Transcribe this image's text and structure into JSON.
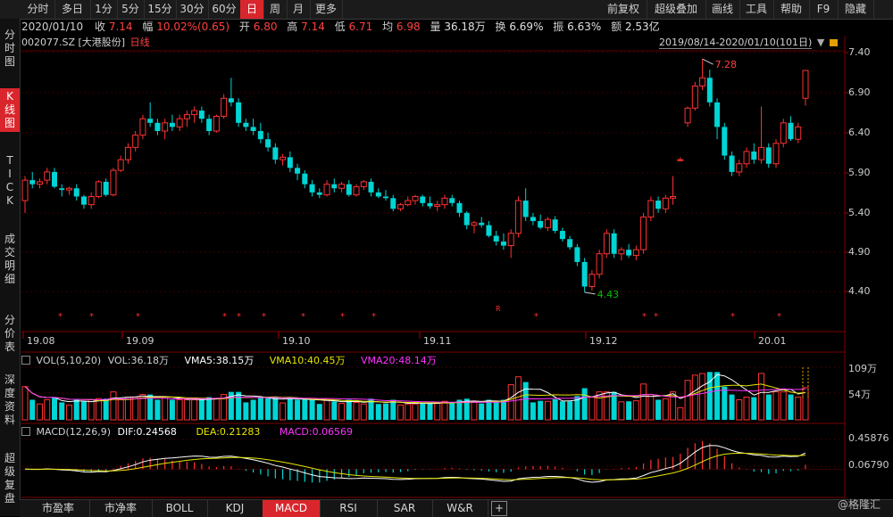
{
  "toolbar": {
    "tabs": [
      "分时",
      "多日",
      "1分",
      "5分",
      "15分",
      "30分",
      "60分",
      "日",
      "周",
      "月",
      "更多"
    ],
    "active_tab": "日",
    "right": [
      "前复权",
      "超级叠加",
      "画线",
      "工具",
      "帮助",
      "F9",
      "隐藏"
    ]
  },
  "info": {
    "date": "2020/01/10",
    "close_label": "收",
    "close": "7.14",
    "change_label": "幅",
    "change": "10.02%(0.65)",
    "open_label": "开",
    "open": "6.80",
    "high_label": "高",
    "high": "7.14",
    "low_label": "低",
    "low": "6.71",
    "avg_label": "均",
    "avg": "6.98",
    "volume_label": "量",
    "volume": "36.18万",
    "turnover_label": "换",
    "turnover": "6.69%",
    "amplitude_label": "振",
    "amplitude": "6.63%",
    "amount_label": "额",
    "amount": "2.53亿"
  },
  "chart_header": {
    "symbol": "002077.SZ",
    "name": "[大港股份]",
    "period": "日线",
    "range": "2019/08/14-2020/01/10(101日)"
  },
  "left_nav": [
    {
      "label": "分\n时\n图",
      "active": false
    },
    {
      "label": "K\n线\n图",
      "active": true
    },
    {
      "label": "T\nI\nC\nK",
      "active": false
    },
    {
      "label": "成\n交\n明\n细",
      "active": false
    },
    {
      "label": "分\n价\n表",
      "active": false
    },
    {
      "label": "深\n度\n资\n料",
      "active": false
    },
    {
      "label": "超\n级\n复\n盘",
      "active": false
    }
  ],
  "price_axis": [
    "7.40",
    "6.90",
    "6.40",
    "5.90",
    "5.40",
    "4.90",
    "4.40"
  ],
  "date_axis": [
    "19.08",
    "19.09",
    "19.10",
    "19.11",
    "19.12",
    "20.01"
  ],
  "annotations": {
    "max_label": "7.28",
    "min_label": "4.43",
    "marker_r": "R"
  },
  "volume_panel": {
    "title": "VOL(5,10,20)",
    "vol_label": "VOL:36.18万",
    "vma5": "VMA5:38.15万",
    "vma10": "VMA10:40.45万",
    "vma20": "VMA20:48.14万",
    "axis": [
      "109万",
      "54万"
    ]
  },
  "macd_panel": {
    "title": "MACD(12,26,9)",
    "dif": "DIF:0.24568",
    "dea": "DEA:0.21283",
    "macd": "MACD:0.06569",
    "axis": [
      "0.45876",
      "0.06790"
    ]
  },
  "bottom_tabs": [
    "市盈率",
    "市净率",
    "BOLL",
    "KDJ",
    "MACD",
    "RSI",
    "SAR",
    "W&R"
  ],
  "active_bottom_tab": "MACD",
  "watermark": "@格隆汇",
  "colors": {
    "up": "#ff3232",
    "down": "#00d5d5",
    "accent": "#d9262c",
    "vma5": "#ffffff",
    "vma10": "#e6e600",
    "vma20": "#ff33ff"
  },
  "chart_data": {
    "type": "candlestick",
    "x": [
      "2019-08-14",
      "2020-01-10"
    ],
    "ylim": [
      4.2,
      7.5
    ],
    "ohlc": [
      [
        5.55,
        5.85,
        5.4,
        5.8
      ],
      [
        5.8,
        5.9,
        5.7,
        5.75
      ],
      [
        5.75,
        5.82,
        5.7,
        5.78
      ],
      [
        5.8,
        5.95,
        5.75,
        5.9
      ],
      [
        5.9,
        5.95,
        5.7,
        5.72
      ],
      [
        5.7,
        5.75,
        5.6,
        5.68
      ],
      [
        5.68,
        5.72,
        5.62,
        5.7
      ],
      [
        5.7,
        5.75,
        5.55,
        5.6
      ],
      [
        5.6,
        5.62,
        5.45,
        5.5
      ],
      [
        5.5,
        5.65,
        5.45,
        5.6
      ],
      [
        5.6,
        5.8,
        5.58,
        5.78
      ],
      [
        5.78,
        5.82,
        5.6,
        5.62
      ],
      [
        5.62,
        5.95,
        5.6,
        5.92
      ],
      [
        5.92,
        6.1,
        5.9,
        6.05
      ],
      [
        6.05,
        6.25,
        6.0,
        6.2
      ],
      [
        6.2,
        6.4,
        6.15,
        6.35
      ],
      [
        6.35,
        6.6,
        6.3,
        6.55
      ],
      [
        6.55,
        6.75,
        6.45,
        6.5
      ],
      [
        6.5,
        6.55,
        6.35,
        6.4
      ],
      [
        6.4,
        6.55,
        6.3,
        6.5
      ],
      [
        6.5,
        6.6,
        6.4,
        6.45
      ],
      [
        6.45,
        6.6,
        6.4,
        6.55
      ],
      [
        6.55,
        6.65,
        6.45,
        6.6
      ],
      [
        6.6,
        6.7,
        6.5,
        6.65
      ],
      [
        6.65,
        6.7,
        6.5,
        6.55
      ],
      [
        6.55,
        6.6,
        6.35,
        6.4
      ],
      [
        6.4,
        6.6,
        6.38,
        6.58
      ],
      [
        6.58,
        6.85,
        6.55,
        6.8
      ],
      [
        6.8,
        7.05,
        6.7,
        6.75
      ],
      [
        6.75,
        6.8,
        6.45,
        6.5
      ],
      [
        6.5,
        6.55,
        6.4,
        6.45
      ],
      [
        6.45,
        6.55,
        6.35,
        6.4
      ],
      [
        6.4,
        6.5,
        6.25,
        6.3
      ],
      [
        6.3,
        6.38,
        6.15,
        6.2
      ],
      [
        6.2,
        6.25,
        6.0,
        6.05
      ],
      [
        6.05,
        6.12,
        5.98,
        6.08
      ],
      [
        6.08,
        6.15,
        5.9,
        5.95
      ],
      [
        5.95,
        6.0,
        5.8,
        5.88
      ],
      [
        5.88,
        5.92,
        5.7,
        5.75
      ],
      [
        5.75,
        5.8,
        5.6,
        5.65
      ],
      [
        5.65,
        5.7,
        5.58,
        5.62
      ],
      [
        5.62,
        5.8,
        5.6,
        5.75
      ],
      [
        5.75,
        5.82,
        5.65,
        5.7
      ],
      [
        5.7,
        5.78,
        5.65,
        5.75
      ],
      [
        5.75,
        5.8,
        5.6,
        5.62
      ],
      [
        5.62,
        5.75,
        5.6,
        5.72
      ],
      [
        5.72,
        5.8,
        5.68,
        5.78
      ],
      [
        5.78,
        5.82,
        5.6,
        5.65
      ],
      [
        5.65,
        5.7,
        5.58,
        5.6
      ],
      [
        5.6,
        5.68,
        5.55,
        5.58
      ],
      [
        5.58,
        5.62,
        5.42,
        5.45
      ],
      [
        5.45,
        5.52,
        5.42,
        5.5
      ],
      [
        5.5,
        5.6,
        5.48,
        5.55
      ],
      [
        5.55,
        5.62,
        5.5,
        5.6
      ],
      [
        5.6,
        5.62,
        5.48,
        5.52
      ],
      [
        5.52,
        5.6,
        5.45,
        5.48
      ],
      [
        5.48,
        5.55,
        5.42,
        5.5
      ],
      [
        5.5,
        5.62,
        5.45,
        5.58
      ],
      [
        5.58,
        5.62,
        5.48,
        5.52
      ],
      [
        5.52,
        5.55,
        5.35,
        5.4
      ],
      [
        5.4,
        5.42,
        5.2,
        5.25
      ],
      [
        5.25,
        5.3,
        5.15,
        5.28
      ],
      [
        5.28,
        5.35,
        5.22,
        5.25
      ],
      [
        5.25,
        5.3,
        5.1,
        5.12
      ],
      [
        5.12,
        5.18,
        5.0,
        5.05
      ],
      [
        5.05,
        5.15,
        4.95,
        5.0
      ],
      [
        5.0,
        5.2,
        4.85,
        5.15
      ],
      [
        5.15,
        5.6,
        5.1,
        5.55
      ],
      [
        5.55,
        5.7,
        5.3,
        5.35
      ],
      [
        5.35,
        5.4,
        5.25,
        5.3
      ],
      [
        5.3,
        5.38,
        5.2,
        5.22
      ],
      [
        5.22,
        5.35,
        5.18,
        5.32
      ],
      [
        5.32,
        5.36,
        5.15,
        5.18
      ],
      [
        5.18,
        5.22,
        5.05,
        5.08
      ],
      [
        5.08,
        5.12,
        4.95,
        4.98
      ],
      [
        4.98,
        5.02,
        4.75,
        4.8
      ],
      [
        4.8,
        4.85,
        4.43,
        4.5
      ],
      [
        4.5,
        4.7,
        4.45,
        4.65
      ],
      [
        4.65,
        4.95,
        4.6,
        4.9
      ],
      [
        4.9,
        5.2,
        4.85,
        5.15
      ],
      [
        5.15,
        5.2,
        4.85,
        4.9
      ],
      [
        4.9,
        4.98,
        4.82,
        4.95
      ],
      [
        4.95,
        5.02,
        4.85,
        4.88
      ],
      [
        4.88,
        5.0,
        4.82,
        4.95
      ],
      [
        4.95,
        5.4,
        4.9,
        5.35
      ],
      [
        5.35,
        5.6,
        5.3,
        5.55
      ],
      [
        5.55,
        5.6,
        5.4,
        5.45
      ],
      [
        5.45,
        5.62,
        5.4,
        5.58
      ],
      [
        5.58,
        5.85,
        5.5,
        5.6
      ],
      [
        6.05,
        6.08,
        6.03,
        6.05
      ],
      [
        6.5,
        6.7,
        6.45,
        6.68
      ],
      [
        6.68,
        7.0,
        6.65,
        6.95
      ],
      [
        6.95,
        7.28,
        6.9,
        7.05
      ],
      [
        7.05,
        7.15,
        6.7,
        6.75
      ],
      [
        6.75,
        6.8,
        6.3,
        6.45
      ],
      [
        6.45,
        6.5,
        6.05,
        6.1
      ],
      [
        6.1,
        6.15,
        5.85,
        5.9
      ],
      [
        5.9,
        6.05,
        5.85,
        6.0
      ],
      [
        6.0,
        6.2,
        5.95,
        6.15
      ],
      [
        6.15,
        6.25,
        6.0,
        6.05
      ],
      [
        6.05,
        6.7,
        6.0,
        6.2
      ],
      [
        6.2,
        6.25,
        5.95,
        6.0
      ],
      [
        6.0,
        6.3,
        5.95,
        6.25
      ],
      [
        6.25,
        6.55,
        6.2,
        6.5
      ],
      [
        6.5,
        6.58,
        6.28,
        6.3
      ],
      [
        6.3,
        6.5,
        6.25,
        6.45
      ],
      [
        6.8,
        7.14,
        6.71,
        7.14
      ]
    ]
  }
}
